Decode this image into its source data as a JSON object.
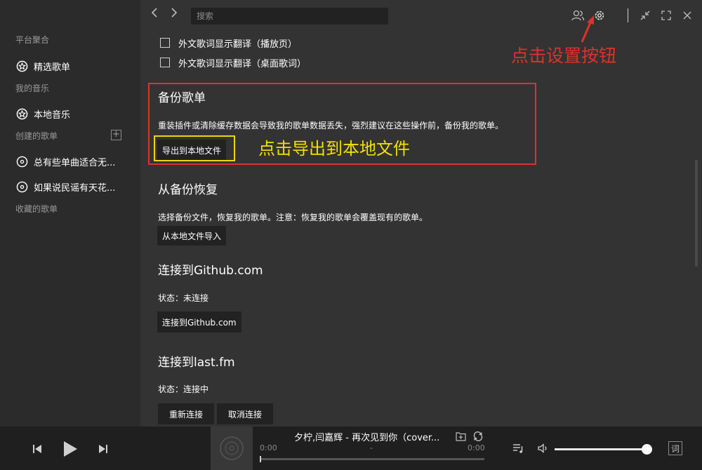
{
  "sidebar": {
    "sections": {
      "platform": "平台聚合",
      "my_music": "我的音乐",
      "created": "创建的歌单",
      "collected": "收藏的歌单"
    },
    "items": {
      "featured": {
        "label": "精选歌单",
        "icon": "star-icon"
      },
      "local": {
        "label": "本地音乐",
        "icon": "star-icon"
      },
      "playlist1": {
        "label": "总有些单曲适合无...",
        "icon": "disc-icon"
      },
      "playlist2": {
        "label": "如果说民谣有天花...",
        "icon": "disc-icon"
      }
    },
    "add_playlist_label": "+"
  },
  "topbar": {
    "search_placeholder": "搜索",
    "icons": [
      "chevron-left-icon",
      "chevron-right-icon",
      "users-icon",
      "gear-icon",
      "minimize-icon",
      "fullscreen-icon",
      "close-icon"
    ]
  },
  "settings": {
    "lyric_option_1": "外文歌词显示翻译（播放页）",
    "lyric_option_2": "外文歌词显示翻译（桌面歌词）",
    "backup": {
      "title": "备份歌单",
      "desc": "重装插件或清除缓存数据会导致我的歌单数据丢失，强烈建议在这些操作前，备份我的歌单。",
      "button": "导出到本地文件"
    },
    "restore": {
      "title": "从备份恢复",
      "desc": "选择备份文件，恢复我的歌单。注意：恢复我的歌单会覆盖现有的歌单。",
      "button": "从本地文件导入"
    },
    "github": {
      "title": "连接到Github.com",
      "status": "状态：未连接",
      "button": "连接到Github.com"
    },
    "lastfm": {
      "title": "连接到last.fm",
      "status": "状态：连接中",
      "reconnect": "重新连接",
      "cancel": "取消连接"
    }
  },
  "annotations": {
    "export_hint": "点击导出到本地文件",
    "settings_hint": "点击设置按钮",
    "colors": {
      "red": "#e0312a",
      "yellow": "#ecd800"
    }
  },
  "player": {
    "title": "夕柠,闫嘉辉 - 再次见到你（cover...",
    "time_current": "0:00",
    "time_separator": "-",
    "time_total": "0:00",
    "progress": 0,
    "volume": 0.97,
    "lyrics_button": "词"
  }
}
